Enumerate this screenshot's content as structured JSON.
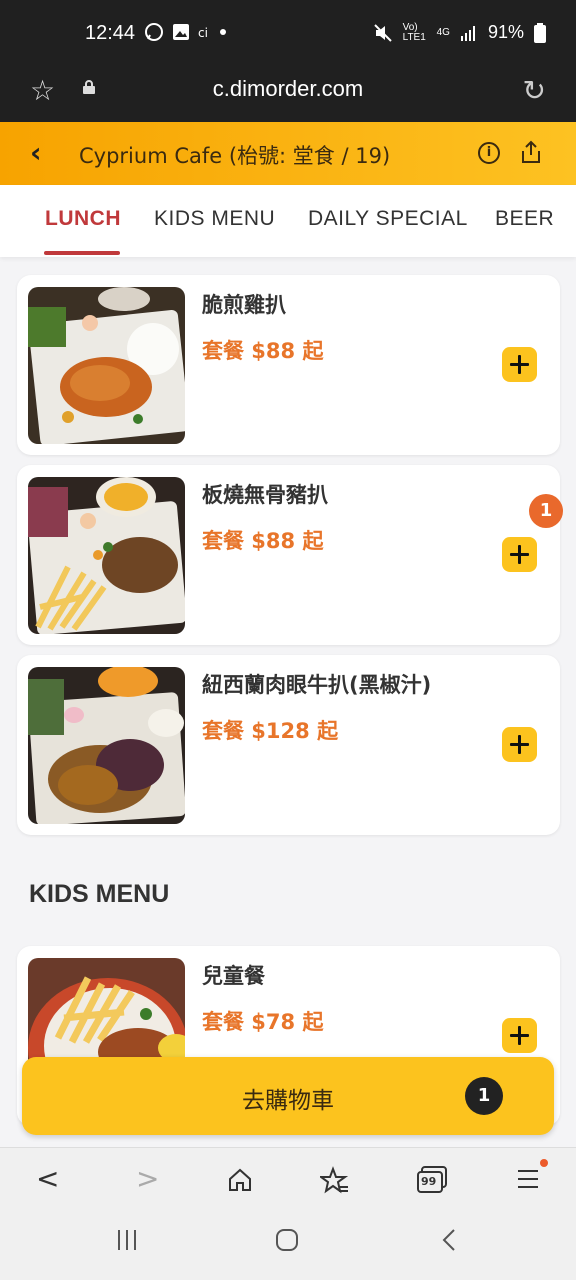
{
  "status_bar": {
    "time": "12:44",
    "battery": "91%",
    "network": "4G",
    "volte": "Vo) LTE1"
  },
  "browser": {
    "url": "c.dimorder.com"
  },
  "header": {
    "title": "Cyprium Cafe (枱號: 堂食 / 19)"
  },
  "tabs": [
    {
      "label": "LUNCH",
      "active": true
    },
    {
      "label": "KIDS MENU",
      "active": false
    },
    {
      "label": "DAILY SPECIAL",
      "active": false
    },
    {
      "label": "BEER",
      "active": false
    }
  ],
  "menu": {
    "items": [
      {
        "name": "脆煎雞扒",
        "price": "套餐 $88 起"
      },
      {
        "name": "板燒無骨豬扒",
        "price": "套餐 $88 起",
        "count": "1"
      },
      {
        "name": "紐西蘭肉眼牛扒(黑椒汁)",
        "price": "套餐 $128 起"
      }
    ],
    "kids_section_title": "KIDS MENU",
    "kids_items": [
      {
        "name": "兒童餐",
        "price": "套餐 $78 起"
      }
    ]
  },
  "cart": {
    "label": "去購物車",
    "count": "1"
  },
  "browser_nav": {
    "tab_count": "99"
  },
  "icons": {
    "back": "chevron-left-icon",
    "info": "info-icon",
    "share": "share-icon",
    "add": "plus-icon"
  },
  "colors": {
    "accent": "#fcc31e",
    "header_gradient_start": "#f7a300",
    "price": "#e8752a",
    "active_tab": "#c0393b",
    "badge": "#e9692c"
  }
}
